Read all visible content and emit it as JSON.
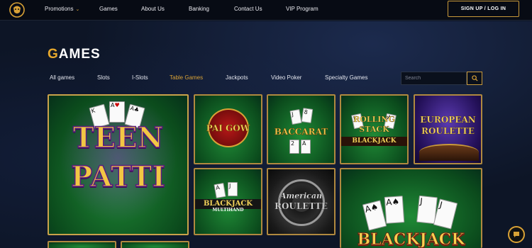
{
  "nav": {
    "items": [
      {
        "label": "Promotions",
        "has_dropdown": true
      },
      {
        "label": "Games"
      },
      {
        "label": "About Us"
      },
      {
        "label": "Banking"
      },
      {
        "label": "Contact Us"
      },
      {
        "label": "VIP Program"
      }
    ],
    "signup_label": "SIGN UP / LOG IN"
  },
  "section": {
    "title_first": "G",
    "title_rest": "AMES"
  },
  "tabs": [
    {
      "label": "All games"
    },
    {
      "label": "Slots"
    },
    {
      "label": "I-Slots"
    },
    {
      "label": "Table Games",
      "active": true
    },
    {
      "label": "Jackpots"
    },
    {
      "label": "Video Poker"
    },
    {
      "label": "Specialty Games"
    }
  ],
  "search": {
    "placeholder": "Search",
    "icon": "search-icon"
  },
  "games": [
    {
      "name": "TEEN PATTI"
    },
    {
      "name": "PAI GOW"
    },
    {
      "name": "BACCARAT"
    },
    {
      "name": "ROLLING STACK BLACKJACK"
    },
    {
      "name": "EUROPEAN ROULETTE"
    },
    {
      "name": "BLACKJACK MULTIHAND"
    },
    {
      "name": "American Roulette"
    },
    {
      "name": "BLACKJACK"
    }
  ],
  "game_text": {
    "teen": "TEEN",
    "patti": "PATTI",
    "pai_gow": "PAI GOW",
    "baccarat": "BACCARAT",
    "rolling": "ROLLING",
    "stack": "STACK",
    "blackjack": "BLACKJACK",
    "european": "EUROPEAN",
    "roulette": "ROULETTE",
    "blackjack_mh": "BLACKJACK",
    "multihand": "MULTIHAND",
    "american": "American",
    "roulette_am": "ROULETTE",
    "blackjack_big": "BLACKJACK"
  },
  "chat": {
    "icon": "chat-icon"
  },
  "colors": {
    "accent": "#d9a236",
    "background": "#0d1526",
    "topbar": "#070b14"
  }
}
